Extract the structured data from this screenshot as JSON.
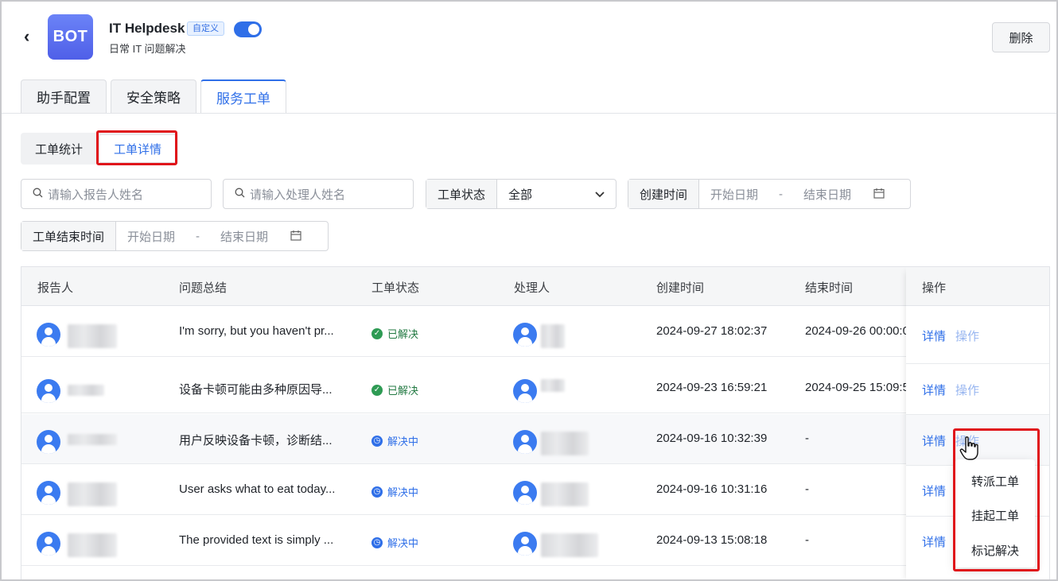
{
  "header": {
    "back_glyph": "‹",
    "logo_text": "BOT",
    "bot_name": "IT Helpdesk",
    "badge": "自定义",
    "description": "日常 IT 问题解决",
    "delete_label": "删除",
    "toggle_on": true
  },
  "tabs": [
    {
      "label": "助手配置",
      "active": false
    },
    {
      "label": "安全策略",
      "active": false
    },
    {
      "label": "服务工单",
      "active": true
    }
  ],
  "subtabs": [
    {
      "label": "工单统计",
      "active": false
    },
    {
      "label": "工单详情",
      "active": true
    }
  ],
  "filters": {
    "reporter_placeholder": "请输入报告人姓名",
    "handler_placeholder": "请输入处理人姓名",
    "status_label": "工单状态",
    "status_value": "全部",
    "created_label": "创建时间",
    "end_label": "工单结束时间",
    "start_date_placeholder": "开始日期",
    "end_date_placeholder": "结束日期",
    "range_sep": "-"
  },
  "table": {
    "columns": [
      "报告人",
      "问题总结",
      "工单状态",
      "处理人",
      "创建时间",
      "结束时间",
      "操作"
    ],
    "rows": [
      {
        "summary": "I'm sorry, but you haven't pr...",
        "status": "已解决",
        "status_type": "ok",
        "created": "2024-09-27 18:02:37",
        "ended": "2024-09-26 00:00:0",
        "detail": "详情",
        "op": "操作"
      },
      {
        "summary": "设备卡顿可能由多种原因导...",
        "status": "已解决",
        "status_type": "ok",
        "created": "2024-09-23 16:59:21",
        "ended": "2024-09-25 15:09:5",
        "detail": "详情",
        "op": "操作"
      },
      {
        "summary": "用户反映设备卡顿，诊断结...",
        "status": "解决中",
        "status_type": "ing",
        "created": "2024-09-16 10:32:39",
        "ended": "-",
        "detail": "详情",
        "op": "操作"
      },
      {
        "summary": "User asks what to eat today...",
        "status": "解决中",
        "status_type": "ing",
        "created": "2024-09-16 10:31:16",
        "ended": "-",
        "detail": "详情",
        "op": ""
      },
      {
        "summary": "The provided text is simply ...",
        "status": "解决中",
        "status_type": "ing",
        "created": "2024-09-13 15:08:18",
        "ended": "-",
        "detail": "详情",
        "op": ""
      }
    ]
  },
  "menu": {
    "items": [
      "转派工单",
      "挂起工单",
      "标记解决"
    ]
  },
  "icons": {
    "search": "search-icon",
    "calendar": "calendar-icon",
    "chevron": "chevron-down-icon",
    "user": "user-avatar-icon",
    "check": "check-circle-icon",
    "clock": "clock-icon"
  },
  "colors": {
    "accent": "#2f6fe8",
    "highlight": "#e0141a",
    "success": "#2e9b54"
  }
}
